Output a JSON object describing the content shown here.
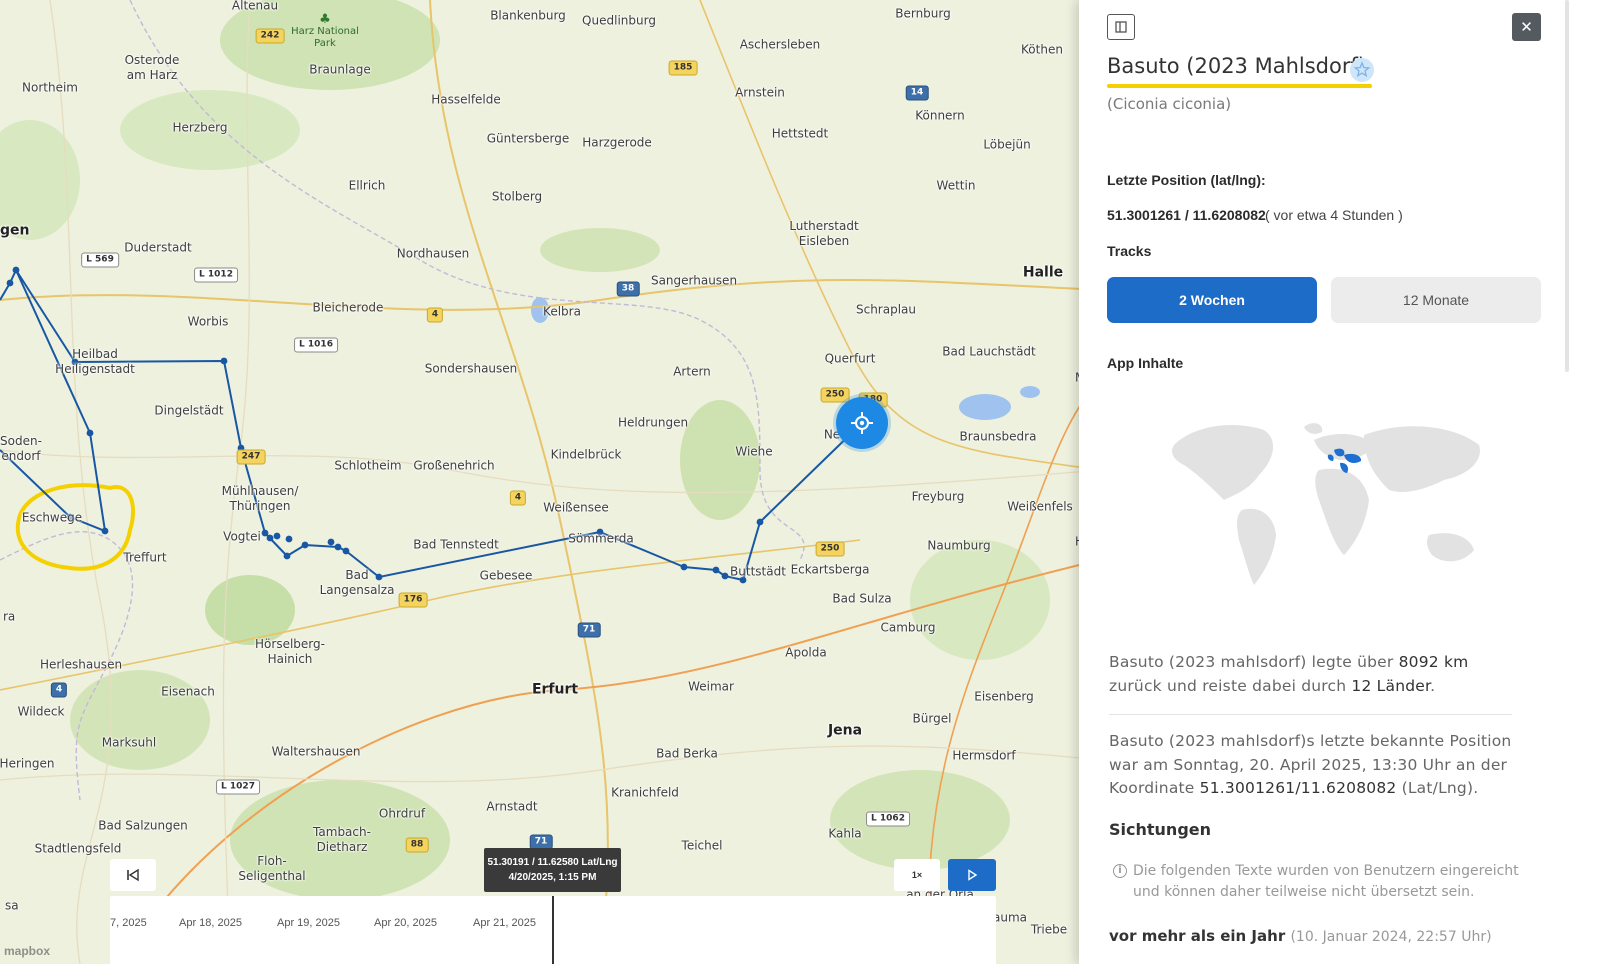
{
  "map": {
    "places": [
      {
        "name": "Altenau"
      },
      {
        "name": "Blankenburg"
      },
      {
        "name": "Quedlinburg"
      },
      {
        "name": "Bernburg"
      },
      {
        "name": "Osterode\nam Harz"
      },
      {
        "name": "Braunlage"
      },
      {
        "name": "Aschersleben"
      },
      {
        "name": "Köthen"
      },
      {
        "name": "Northeim"
      },
      {
        "name": "Hasselfelde"
      },
      {
        "name": "Arnstein"
      },
      {
        "name": "Könnern"
      },
      {
        "name": "Herzberg"
      },
      {
        "name": "Güntersberge"
      },
      {
        "name": "Harzgerode"
      },
      {
        "name": "Hettstedt"
      },
      {
        "name": "Löbejün"
      },
      {
        "name": "Ellrich"
      },
      {
        "name": "Wettin"
      },
      {
        "name": "Stolberg"
      },
      {
        "name": "Lutherstadt\nEisleben"
      },
      {
        "name": "gen"
      },
      {
        "name": "Duderstadt"
      },
      {
        "name": "Nordhausen"
      },
      {
        "name": "Sangerhausen"
      },
      {
        "name": "Halle"
      },
      {
        "name": "Kelbra"
      },
      {
        "name": "Bleicherode"
      },
      {
        "name": "Schraplau"
      },
      {
        "name": "Worbis"
      },
      {
        "name": "Heilbad\nHeiligenstadt"
      },
      {
        "name": "Sondershausen"
      },
      {
        "name": "Querfurt"
      },
      {
        "name": "Bad Lauchstädt"
      },
      {
        "name": "Artern"
      },
      {
        "name": "Merseburg"
      },
      {
        "name": "Dingelstädt"
      },
      {
        "name": "Heldrungen"
      },
      {
        "name": "Braunsbedra"
      },
      {
        "name": "Soden-\nendorf"
      },
      {
        "name": "Ne"
      },
      {
        "name": "Wiehe"
      },
      {
        "name": "Schlotheim"
      },
      {
        "name": "Großenehrich"
      },
      {
        "name": "Kindelbrück"
      },
      {
        "name": "Freyburg"
      },
      {
        "name": "Mühlhausen/\nThüringen"
      },
      {
        "name": "Weißensee"
      },
      {
        "name": "Weißenfels"
      },
      {
        "name": "Eschwege"
      },
      {
        "name": "Vogtei"
      },
      {
        "name": "Sömmerda"
      },
      {
        "name": "Treffurt"
      },
      {
        "name": "Bad Tennstedt"
      },
      {
        "name": "Buttstädt"
      },
      {
        "name": "Naumburg"
      },
      {
        "name": "Bad\nLangensalza"
      },
      {
        "name": "Gebesee"
      },
      {
        "name": "Eckartsberga"
      },
      {
        "name": "Bad Sulza"
      },
      {
        "name": "Camburg"
      },
      {
        "name": "Hörselberg-\nHainich"
      },
      {
        "name": "Apolda"
      },
      {
        "name": "Herleshausen"
      },
      {
        "name": "Erfurt"
      },
      {
        "name": "Eisenach"
      },
      {
        "name": "Weimar"
      },
      {
        "name": "Eisenberg"
      },
      {
        "name": "Wildeck"
      },
      {
        "name": "Bürgel"
      },
      {
        "name": "Marksuhl"
      },
      {
        "name": "Jena"
      },
      {
        "name": "Heringen"
      },
      {
        "name": "Waltershausen"
      },
      {
        "name": "Bad Berka"
      },
      {
        "name": "Hermsdorf"
      },
      {
        "name": "Kranichfeld"
      },
      {
        "name": "Ohrdruf"
      },
      {
        "name": "Arnstadt"
      },
      {
        "name": "Bad Salzungen"
      },
      {
        "name": "Tambach-\nDietharz"
      },
      {
        "name": "Kahla"
      },
      {
        "name": "Stadtlengsfeld"
      },
      {
        "name": "Teichel"
      },
      {
        "name": "Floh-\nSeligenthal"
      },
      {
        "name": "Triebe"
      },
      {
        "name": "auma"
      },
      {
        "name": "an der Orla"
      },
      {
        "name": "ra"
      },
      {
        "name": "sa"
      },
      {
        "name": "H"
      }
    ],
    "park": "Harz National\nPark",
    "shields": [
      "242",
      "185",
      "14",
      "L 569",
      "L 1012",
      "38",
      "4",
      "L 1016",
      "250",
      "180",
      "247",
      "4",
      "250",
      "176",
      "71",
      "4",
      "L 1027",
      "88",
      "71",
      "L 1062"
    ]
  },
  "tooltip": {
    "coords": "51.30191 / 11.62580 Lat/Lng",
    "time": "4/20/2025, 1:15 PM"
  },
  "controls": {
    "speed": "1×",
    "back_icon": "skip-back-icon",
    "play_icon": "play-icon"
  },
  "timeline": {
    "dates": [
      "7, 2025",
      "Apr 18, 2025",
      "Apr 19, 2025",
      "Apr 20, 2025",
      "Apr 21, 2025"
    ]
  },
  "map_logo": "mapbox",
  "panel": {
    "title": "Basuto (2023 Mahlsdorf)",
    "scientific_name": "(Ciconia ciconia)",
    "last_position_label": "Letzte Position (lat/lng):",
    "last_position_value": "51.3001261 / 11.6208082",
    "last_position_age": "( vor etwa 4 Stunden )",
    "tracks_label": "Tracks",
    "track_options": [
      "2 Wochen",
      "12 Monate"
    ],
    "app_content_label": "App Inhalte",
    "summary": {
      "prefix": "Basuto (2023 mahlsdorf) legte über ",
      "distance": "8092 km",
      "middle": " zurück und reiste dabei durch ",
      "countries": "12 Länder",
      "suffix": "."
    },
    "last_known": {
      "prefix": "Basuto (2023 mahlsdorf)s letzte bekannte Position war am Sonntag, 20. April 2025, 13:30 Uhr an der Koordinate ",
      "coords": "51.3001261/11.6208082",
      "suffix": " (Lat/Lng)."
    },
    "sightings_label": "Sichtungen",
    "sightings_note": "Die folgenden Texte wurden von Benutzern eingereicht und können daher teilweise nicht übersetzt sein.",
    "entry_title": "vor mehr als ein Jahr",
    "entry_date": "(10. Januar 2024, 22:57 Uhr)"
  },
  "colors": {
    "track": "#1857a4",
    "accent": "#1d6cc8",
    "highlight": "#f5d000"
  }
}
